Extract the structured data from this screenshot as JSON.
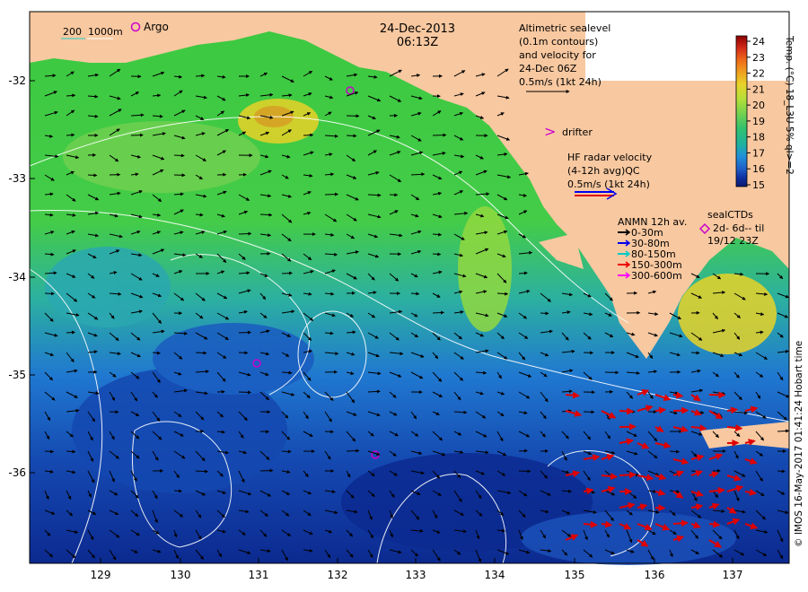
{
  "header": {
    "date": "24-Dec-2013",
    "time": "06:13Z"
  },
  "scale_bar": {
    "label_200": "200",
    "label_1000": "1000m"
  },
  "argo": {
    "label": "Argo",
    "color": "#cc00cc"
  },
  "altimetry": {
    "lines": [
      "Altimetric sealevel",
      "(0.1m contours)",
      "and velocity for",
      "24-Dec 06Z",
      "0.5m/s (1kt 24h)"
    ]
  },
  "drifter": {
    "symbol": ">",
    "label": "drifter",
    "color": "#cc00cc"
  },
  "hf_radar": {
    "lines": [
      "HF radar velocity",
      "(4-12h avg)QC",
      "0.5m/s (1kt 24h)"
    ]
  },
  "anmn": {
    "title": "ANMN 12h av.",
    "items": [
      {
        "label": "0-30m",
        "color": "#000000"
      },
      {
        "label": "30-80m",
        "color": "#0000ee"
      },
      {
        "label": "80-150m",
        "color": "#00c8c8"
      },
      {
        "label": "150-300m",
        "color": "#ee0000"
      },
      {
        "label": "300-600m",
        "color": "#ff00ff"
      }
    ]
  },
  "sealctds": {
    "title": "sealCTDs",
    "line1": "2d- 6d-- til",
    "line2": "19/12 23Z",
    "color": "#cc00cc"
  },
  "colorbar": {
    "ticks": [
      "24",
      "23",
      "22",
      "21",
      "20",
      "19",
      "18",
      "17",
      "16",
      "15"
    ],
    "label": "Temp. (°C) 18_L3U 5% ql>=2",
    "colors": [
      "#8b0000",
      "#d42a1a",
      "#ee6a1a",
      "#f0a020",
      "#e8d228",
      "#b4e03a",
      "#70d050",
      "#30c070",
      "#20b0a0",
      "#2090d8",
      "#2060c8",
      "#1030a0",
      "#0a1a70"
    ]
  },
  "axes": {
    "x_ticks": [
      "129",
      "130",
      "131",
      "132",
      "133",
      "134",
      "135",
      "136",
      "137"
    ],
    "y_ticks": [
      "-32",
      "-33",
      "-34",
      "-35",
      "-36"
    ]
  },
  "credit": "© IMOS 16-May-2017 01:41:24 Hobart time",
  "land_color": "#f8c8a0"
}
